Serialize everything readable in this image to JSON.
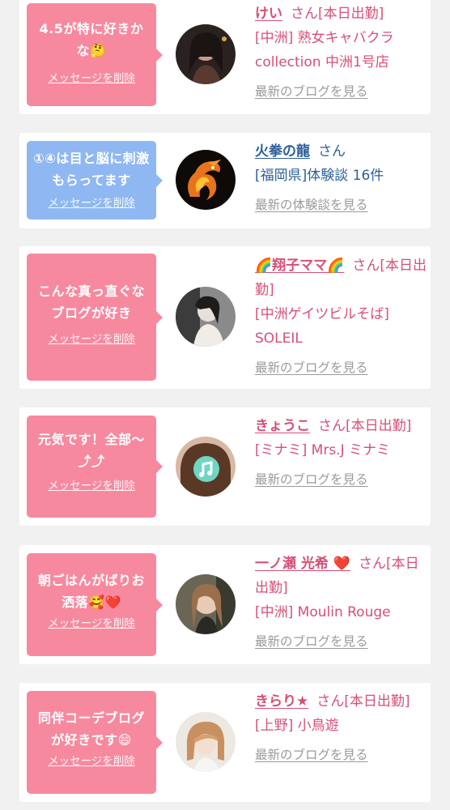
{
  "colors": {
    "bubble_pink": "#f7899f",
    "bubble_blue": "#8fb7f2",
    "name_pink": "#d84f75",
    "name_blue": "#2c5f9a",
    "link_gray": "#9a9a9a"
  },
  "messages": [
    {
      "bubble_text": "4.5が特に好きかな🤔",
      "delete_label": "メッセージを削除",
      "name": "けい",
      "honorific": "さん[本日出勤]",
      "shop": "[中洲] 熟女キャバクラ collection 中洲1号店",
      "link": "最新のブログを見る"
    },
    {
      "bubble_text": "①④は目と脳に刺激もらってます",
      "delete_label": "メッセージを削除",
      "name": "火拳の龍",
      "honorific": "さん",
      "shop": "[福岡県]体験談 16件",
      "link": "最新の体験談を見る"
    },
    {
      "bubble_text": "こんな真っ直ぐなブログが好き",
      "delete_label": "メッセージを削除",
      "name": "🌈翔子ママ🌈",
      "honorific": "さん[本日出勤]",
      "shop": "[中洲ゲイツビルそば] SOLEIL",
      "link": "最新のブログを見る"
    },
    {
      "bubble_text": "元気です！全部〜⤴︎⤴︎",
      "delete_label": "メッセージを削除",
      "name": "きょうこ",
      "honorific": "さん[本日出勤]",
      "shop": "[ミナミ] Mrs.J ミナミ",
      "link": "最新のブログを見る"
    },
    {
      "bubble_text": "朝ごはんがばりお洒落🥰❤️",
      "delete_label": "メッセージを削除",
      "name": "一ノ瀬 光希 ❤️",
      "honorific": "さん[本日出勤]",
      "shop": "[中洲] Moulin Rouge",
      "link": "最新のブログを見る"
    },
    {
      "bubble_text": "同伴コーデブログが好きです😄",
      "delete_label": "メッセージを削除",
      "name": "きらり★",
      "honorific": "さん[本日出勤]",
      "shop": "[上野] 小鳥遊",
      "link": "最新のブログを見る"
    }
  ]
}
